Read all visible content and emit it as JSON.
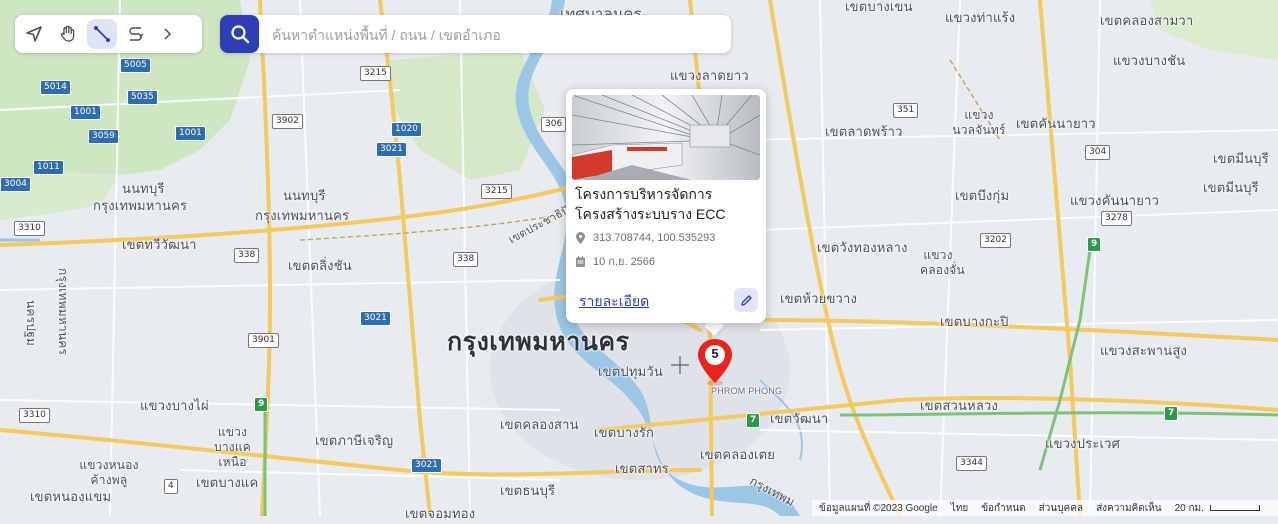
{
  "toolbar": {
    "tools": [
      "navigate-icon",
      "hand-pan-icon",
      "measure-line-icon",
      "draw-path-icon"
    ],
    "active_tool": "measure-line-icon",
    "more": "chevron-right-icon"
  },
  "search": {
    "placeholder": "ค้นหาตำแหน่งพื้นที่ / ถนน / เขตอำเภอ",
    "value": ""
  },
  "popup": {
    "title": "โครงการบริหารจัดการโครงสร้างระบบราง ECC",
    "coordinates": "313.708744, 100.535293",
    "date": "10 ก.ย. 2566",
    "details_link": "รายละเอียด",
    "icons": [
      "location-pin-icon",
      "calendar-icon",
      "edit-icon"
    ]
  },
  "marker": {
    "count": "5",
    "color": "#e8241c"
  },
  "map": {
    "city_label": "กรุงเทพมหานคร",
    "labels": [
      "เทศบาลนคร",
      "เขตบางเขน",
      "แขวงท่าแร้ง",
      "เขตคลองสามวา",
      "แขวงบางชัน",
      "แขวงลาดยาว",
      "เขตลาดพร้าว",
      "แขวงนวลจันทร์",
      "เขตคันนายาว",
      "เขตมีนบุรี",
      "นนทบุรี",
      "กรุงเทพมหานคร",
      "นนทบุรี",
      "กรุงเทพมหานคร",
      "เขตบึงกุ่ม",
      "แขวงคันนายาว",
      "เขตมีนบุรี",
      "เขตทวีวัฒนา",
      "เขตตลิ่งชัน",
      "เขตวังทองหลาง",
      "แขวงคลองจั่น",
      "เขตห้วยขวาง",
      "เขตบางกะปิ",
      "แขวงสะพานสูง",
      "เขตปทุมวัน",
      "PHROM PHONG",
      "แขวงบางไผ่",
      "แขวงบางแคเหนือ",
      "เขตภาษีเจริญ",
      "เขตคลองสาน",
      "เขตบางรัก",
      "เขตวัฒนา",
      "เขตสวนหลวง",
      "แขวงประเวศ",
      "เขตสาทร",
      "เขตคลองเตย",
      "แขวงหนองค้างพลู",
      "เขตบางแค",
      "เขตธนบุรี",
      "เขตหนองแขม",
      "เขตจอมทอง",
      "กรุงเทพมหานคร",
      "นครปฐม",
      "เขตประชาธิปัตย์",
      "กรุงเทพม"
    ],
    "shields_blue": [
      "5005",
      "5014",
      "5035",
      "1001",
      "3059",
      "1001",
      "1020",
      "3021",
      "1011",
      "3004",
      "3021",
      "3021"
    ],
    "shields_white": [
      "3215",
      "3902",
      "306",
      "351",
      "304",
      "3215",
      "3310",
      "338",
      "338",
      "3202",
      "3901",
      "3278",
      "3310",
      "3344",
      "4"
    ],
    "shields_green": [
      "9",
      "9",
      "7",
      "7"
    ]
  },
  "footer": {
    "map_data": "ข้อมูลแผนที่ ©2023 Google",
    "language": "ไทย",
    "terms": "ข้อกำหนด",
    "privacy": "ส่วนบุคคล",
    "feedback": "ส่งความคิดเห็น",
    "scale": "20 กม."
  },
  "colors": {
    "accent": "#2e3fb6",
    "marker": "#e8241c",
    "road_major": "#f4c95d",
    "water": "#9cc6e6",
    "park": "#cfe6c2"
  }
}
